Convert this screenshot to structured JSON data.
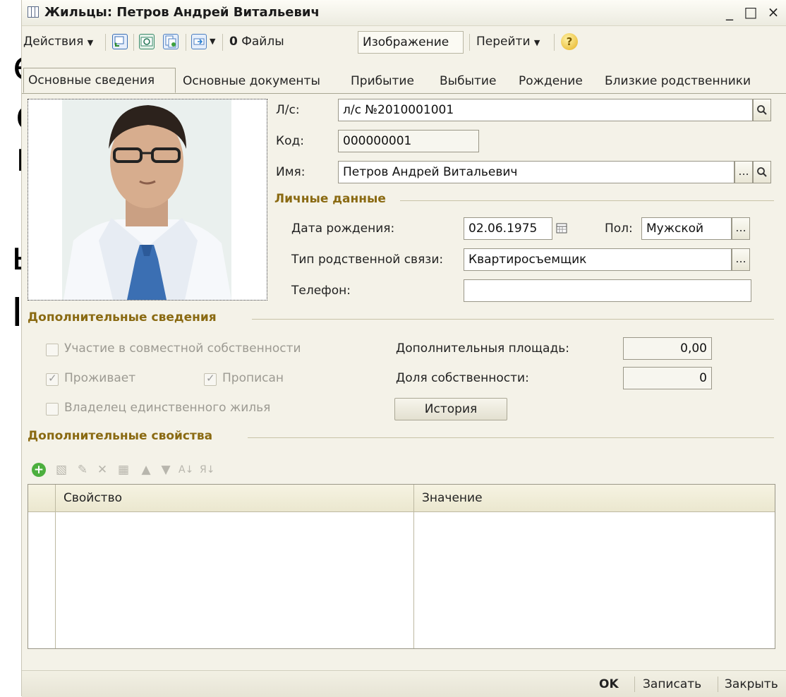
{
  "window": {
    "title": "Жильцы: Петров Андрей Витальевич",
    "minimize": "_",
    "maximize": "□",
    "close": "×"
  },
  "background_fragments": [
    "е",
    "о",
    "к",
    "ы",
    "I"
  ],
  "toolbar": {
    "actions": "Действия",
    "files": "Файлы",
    "image": "Изображение",
    "goto": "Перейти",
    "help": "?"
  },
  "tabs": [
    "Основные сведения",
    "Основные документы",
    "Прибытие",
    "Выбытие",
    "Рождение",
    "Близкие родственники"
  ],
  "main": {
    "account_label": "Л/с:",
    "account_value": "л/с №2010001001",
    "code_label": "Код:",
    "code_value": "000000001",
    "name_label": "Имя:",
    "name_value": "Петров Андрей Витальевич"
  },
  "personal": {
    "title": "Личные данные",
    "birth_label": "Дата рождения:",
    "birth_value": "02.06.1975",
    "gender_label": "Пол:",
    "gender_value": "Мужской",
    "relation_label": "Тип родственной связи:",
    "relation_value": "Квартиросъемщик",
    "phone_label": "Телефон:",
    "phone_value": ""
  },
  "additional": {
    "title": "Дополнительные сведения",
    "joint_ownership": "Участие в совместной собственности",
    "lives": "Проживает",
    "registered": "Прописан",
    "sole_owner": "Владелец единственного жилья",
    "extra_area_label": "Дополнительныя площадь:",
    "extra_area_value": "0,00",
    "share_label": "Доля собственности:",
    "share_value": "0",
    "history_button": "История",
    "checks": {
      "joint_ownership": false,
      "lives": true,
      "registered": true,
      "sole_owner": false
    }
  },
  "properties": {
    "title": "Дополнительные свойства",
    "col_property": "Свойство",
    "col_value": "Значение"
  },
  "footer": {
    "ok": "OK",
    "save": "Записать",
    "close": "Закрыть"
  },
  "colors": {
    "section_title": "#8a6a12",
    "window_bg": "#f4f2e8",
    "table_header_bg": "#ebe7cf"
  }
}
